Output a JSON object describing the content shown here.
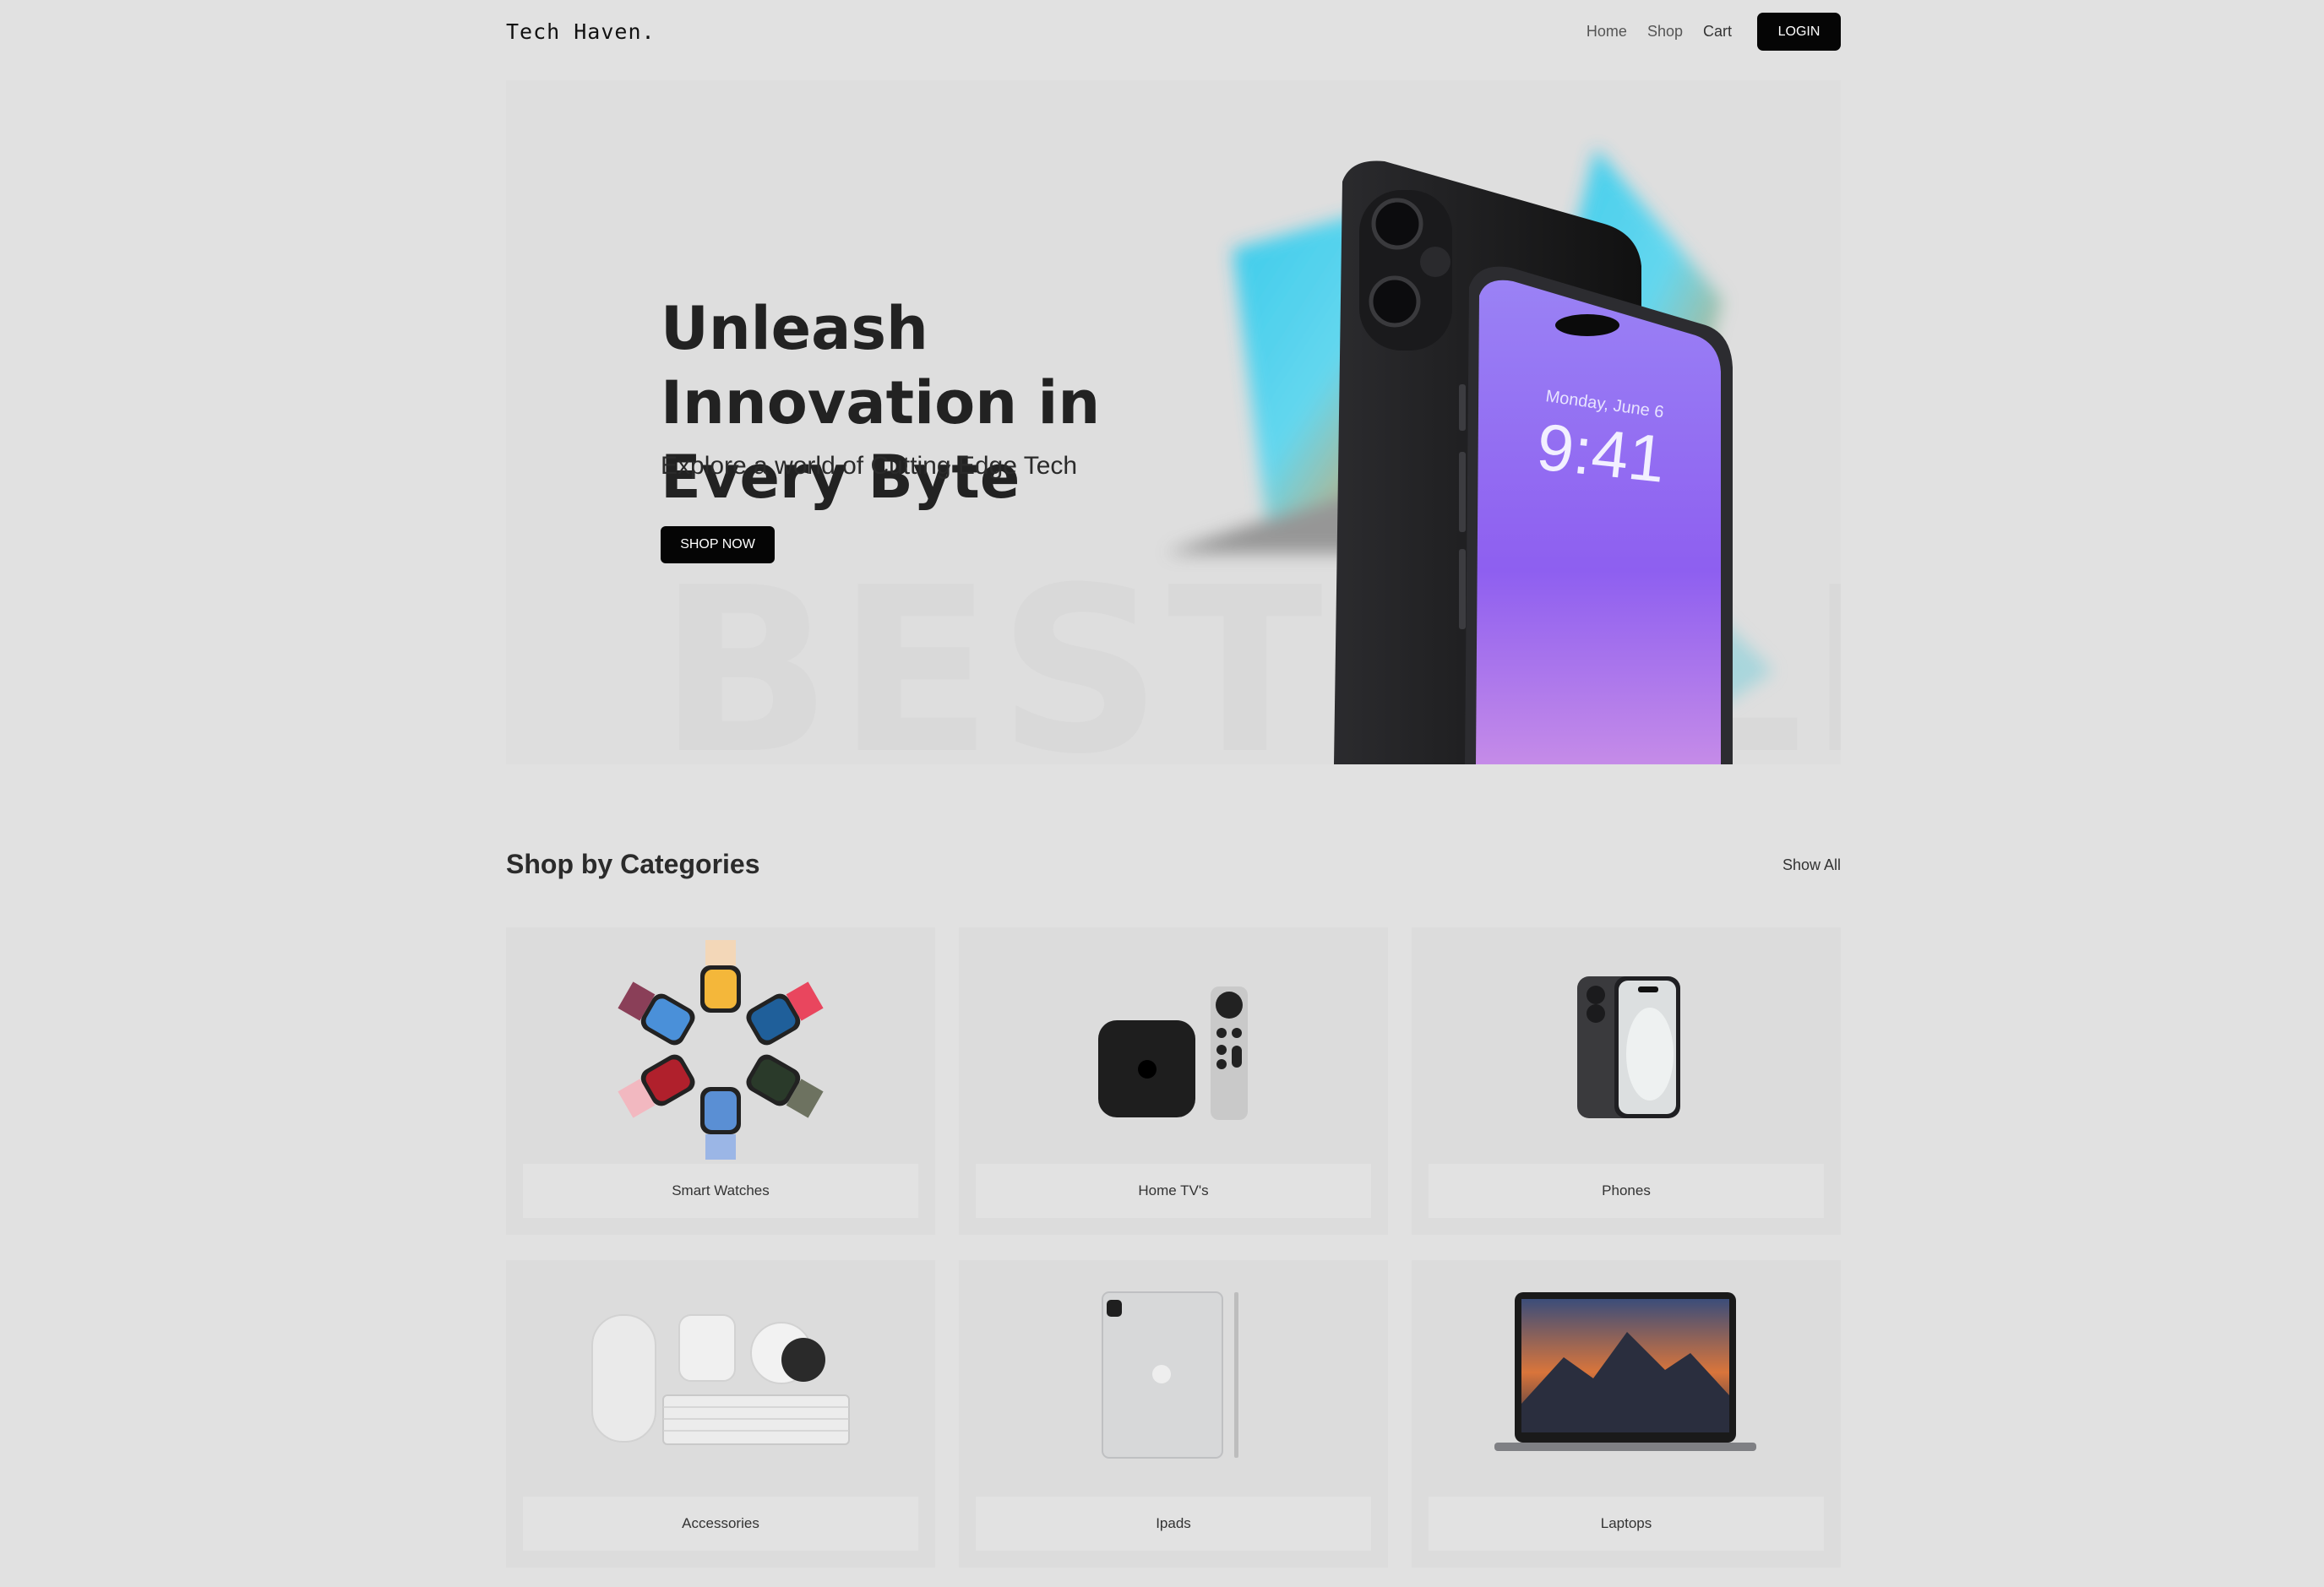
{
  "nav": {
    "brand": "Tech Haven.",
    "links": [
      "Home",
      "Shop",
      "Cart"
    ],
    "login_label": "LOGIN"
  },
  "hero": {
    "title": "Unleash Innovation in Every Byte",
    "subtitle": "Explore a world of Cutting Edge Tech",
    "cta_label": "SHOP NOW",
    "watermark": "BESTSELLER",
    "phone_date": "Monday, June 6",
    "phone_time": "9:41"
  },
  "categories": {
    "heading": "Shop by Categories",
    "show_all_label": "Show All",
    "items": [
      {
        "label": "Smart Watches",
        "icon": "smartwatch-icon"
      },
      {
        "label": "Home TV's",
        "icon": "tv-box-icon"
      },
      {
        "label": "Phones",
        "icon": "phone-icon"
      },
      {
        "label": "Accessories",
        "icon": "accessories-icon"
      },
      {
        "label": "Ipads",
        "icon": "tablet-icon"
      },
      {
        "label": "Laptops",
        "icon": "laptop-icon"
      }
    ]
  },
  "colors": {
    "background": "#e1e1e1",
    "button": "#050505",
    "phone_screen": "#8b5cf6",
    "laptop_screen": "#22c1e6"
  }
}
